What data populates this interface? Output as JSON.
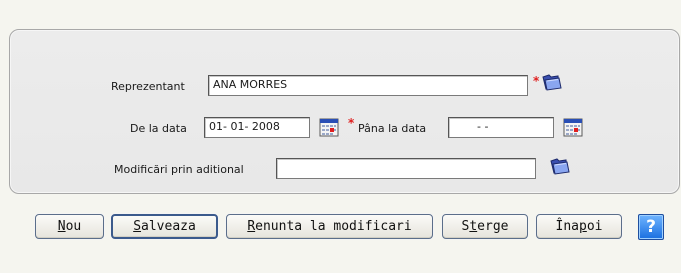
{
  "form": {
    "representative": {
      "label": "Reprezentant",
      "value": "ANA MORRES",
      "required": true
    },
    "from_date": {
      "label": "De la data",
      "value": "01- 01-  2008",
      "required": true
    },
    "to_date": {
      "label": "Pâna la data",
      "value": "-    -",
      "required_marker": "*"
    },
    "modifications": {
      "label": "Modificări prin aditional",
      "value": ""
    },
    "required_marker": "*"
  },
  "buttons": {
    "new": {
      "accel": "N",
      "rest": "ou"
    },
    "save": {
      "accel": "S",
      "rest": "alveaza"
    },
    "cancel": {
      "accel": "R",
      "rest": "enunta la modificari"
    },
    "delete": {
      "pre": "S",
      "accel": "t",
      "rest": "erge"
    },
    "back": {
      "pre": "Îna",
      "accel": "p",
      "rest": "oi"
    },
    "help": "?"
  },
  "icons": {
    "lookup": "folder-icon",
    "calendar": "calendar-icon",
    "help": "help-icon"
  },
  "colors": {
    "required": "#e02020",
    "help_bg": "#1a6fe0"
  }
}
